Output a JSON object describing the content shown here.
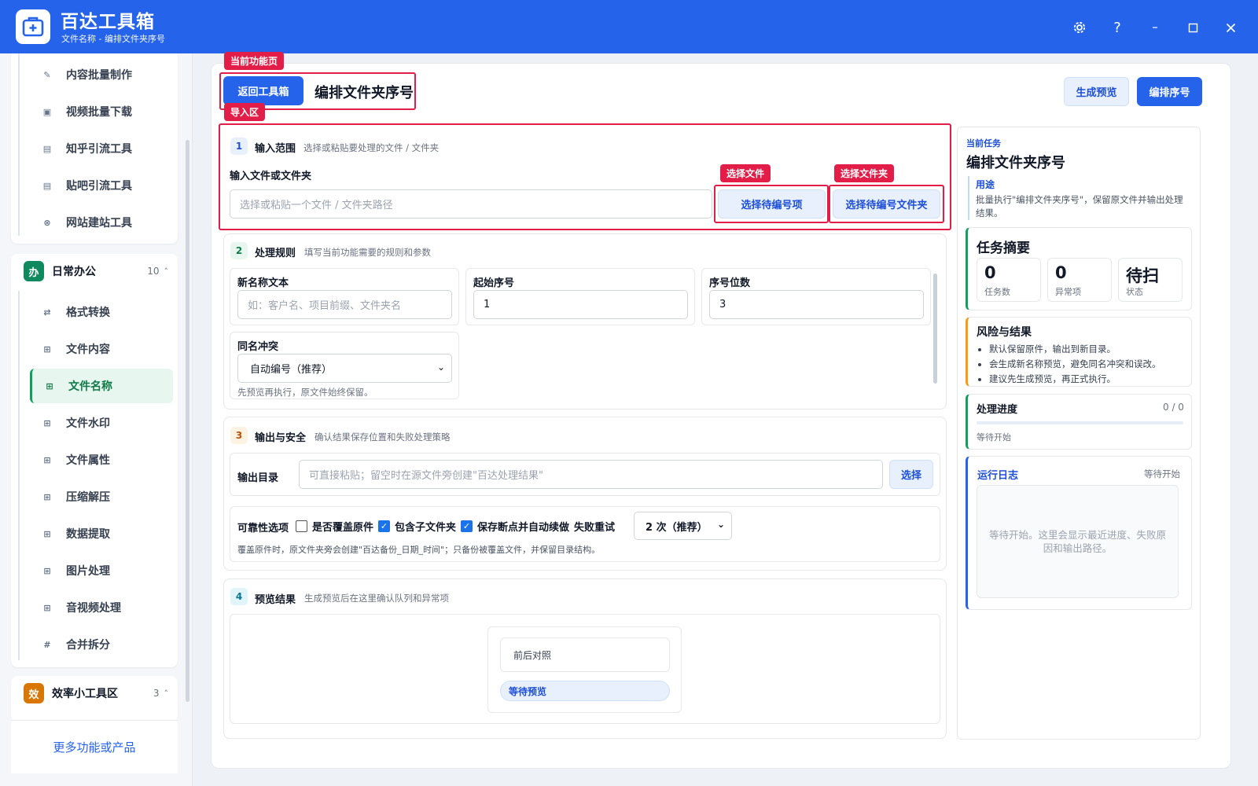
{
  "app": {
    "title": "百达工具箱",
    "subtitle": "文件名称 - 编排文件夹序号"
  },
  "window_icons": [
    "gear-icon",
    "help-icon",
    "minimize-icon",
    "maximize-icon",
    "close-icon"
  ],
  "sidebar": {
    "top_items": [
      {
        "label": "内容批量制作",
        "icon": "pencil-icon",
        "glyph": "✎"
      },
      {
        "label": "视频批量下载",
        "icon": "video-icon",
        "glyph": "▣"
      },
      {
        "label": "知乎引流工具",
        "icon": "zhihu-icon",
        "glyph": "▤"
      },
      {
        "label": "贴吧引流工具",
        "icon": "tieba-icon",
        "glyph": "▤"
      },
      {
        "label": "网站建站工具",
        "icon": "globe-icon",
        "glyph": "⊗"
      }
    ],
    "group_office": {
      "badge": "办",
      "name": "日常办公",
      "count": "10",
      "caret": "˄",
      "color": "#0f8a5f"
    },
    "office_items": [
      {
        "label": "格式转换",
        "icon": "convert-icon",
        "glyph": "⇄"
      },
      {
        "label": "文件内容",
        "icon": "grid-icon",
        "glyph": "⊞"
      },
      {
        "label": "文件名称",
        "icon": "grid-icon",
        "glyph": "⊞"
      },
      {
        "label": "文件水印",
        "icon": "grid-icon",
        "glyph": "⊞"
      },
      {
        "label": "文件属性",
        "icon": "grid-icon",
        "glyph": "⊞"
      },
      {
        "label": "压缩解压",
        "icon": "grid-icon",
        "glyph": "⊞"
      },
      {
        "label": "数据提取",
        "icon": "grid-icon",
        "glyph": "⊞"
      },
      {
        "label": "图片处理",
        "icon": "grid-icon",
        "glyph": "⊞"
      },
      {
        "label": "音视频处理",
        "icon": "grid-icon",
        "glyph": "⊞"
      },
      {
        "label": "合并拆分",
        "icon": "hash-icon",
        "glyph": "#"
      }
    ],
    "active_item": "文件名称",
    "group_efficiency": {
      "badge": "效",
      "name": "效率小工具区",
      "count": "3",
      "caret": "˄",
      "color": "#d97706"
    },
    "more_link": "更多功能或产品"
  },
  "annotations": {
    "current_page": "当前功能页",
    "import_area": "导入区",
    "select_file": "选择文件",
    "select_folder": "选择文件夹"
  },
  "header": {
    "back_button": "返回工具箱",
    "page_title": "编排文件夹序号",
    "preview_button": "生成预览",
    "run_button": "编排序号"
  },
  "section1": {
    "num": "1",
    "title": "输入范围",
    "desc": "选择或粘贴要处理的文件 / 文件夹",
    "field_label": "输入文件或文件夹",
    "placeholder": "选择或粘贴一个文件 / 文件夹路径",
    "btn_items": "选择待编号项",
    "btn_folder": "选择待编号文件夹"
  },
  "section2": {
    "num": "2",
    "title": "处理规则",
    "desc": "填写当前功能需要的规则和参数",
    "new_name_label": "新名称文本",
    "new_name_placeholder": "如：客户名、项目前缀、文件夹名",
    "start_label": "起始序号",
    "start_value": "1",
    "digits_label": "序号位数",
    "digits_value": "3",
    "conflict_label": "同名冲突",
    "conflict_value": "自动编号（推荐）",
    "note": "先预览再执行，原文件始终保留。"
  },
  "section3": {
    "num": "3",
    "title": "输出与安全",
    "desc": "确认结果保存位置和失败处理策略",
    "output_label": "输出目录",
    "output_placeholder": "可直接粘贴；留空时在源文件旁创建\"百达处理结果\"",
    "choose_button": "选择",
    "reliability_label": "可靠性选项",
    "opt_overwrite": "是否覆盖原件",
    "opt_overwrite_checked": false,
    "opt_subfolders": "包含子文件夹",
    "opt_subfolders_checked": true,
    "opt_resume": "保存断点并自动续做",
    "opt_resume_checked": true,
    "retry_label": "失败重试",
    "retry_value": "2 次（推荐）",
    "note": "覆盖原件时，原文件夹旁会创建\"百达备份_日期_时间\"；只备份被覆盖文件，并保留目录结构。"
  },
  "section4": {
    "num": "4",
    "title": "预览结果",
    "desc": "生成预览后在这里确认队列和异常项",
    "compare_label": "前后对照",
    "status_pill": "等待预览"
  },
  "right_panel": {
    "current_task_label": "当前任务",
    "task_title": "编排文件夹序号",
    "purpose_label": "用途",
    "purpose_text": "批量执行\"编排文件夹序号\"，保留原文件并输出处理结果。",
    "summary_title": "任务摘要",
    "stats": [
      {
        "value": "0",
        "label": "任务数"
      },
      {
        "value": "0",
        "label": "异常项"
      },
      {
        "value": "待扫",
        "label": "状态"
      }
    ],
    "risk_title": "风险与结果",
    "risks": [
      "默认保留原件，输出到新目录。",
      "会生成新名称预览，避免同名冲突和误改。",
      "建议先生成预览，再正式执行。"
    ],
    "progress_title": "处理进度",
    "progress_count": "0 / 0",
    "progress_fraction": 0,
    "progress_status": "等待开始",
    "log_title": "运行日志",
    "log_status": "等待开始",
    "log_placeholder": "等待开始。这里会显示最近进度、失败原因和输出路径。"
  },
  "colors": {
    "brand": "#2563eb",
    "annotation_red": "#e11d48",
    "active_green": "#10a05c"
  }
}
